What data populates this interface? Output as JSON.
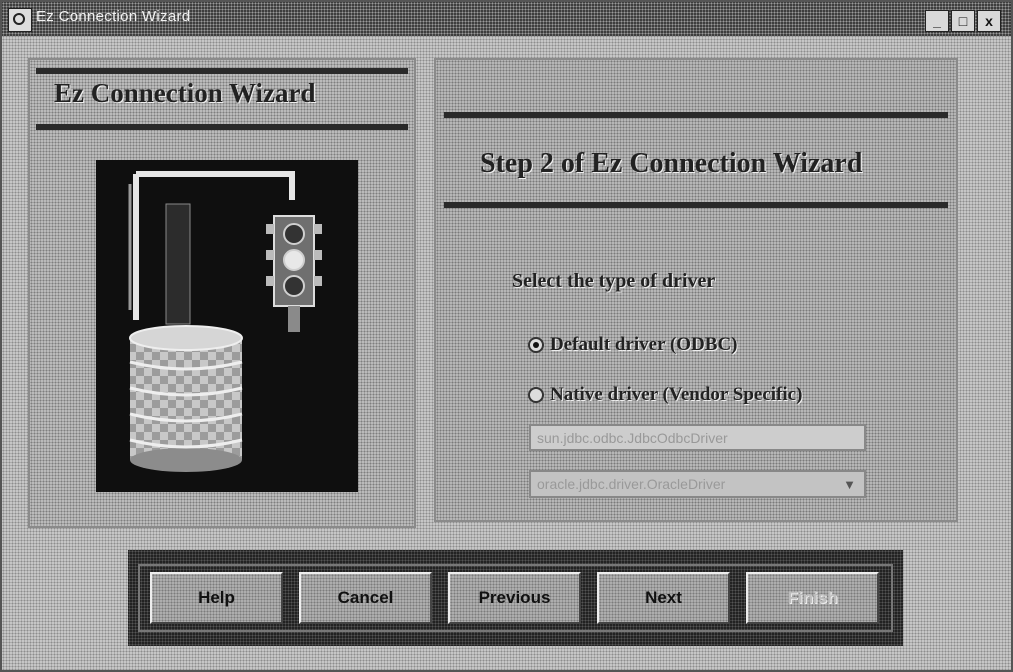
{
  "window": {
    "title": "Ez Connection Wizard",
    "controls": [
      "_",
      "□",
      "x"
    ]
  },
  "left_panel": {
    "title": "Ez Connection Wizard",
    "graphic_icons": [
      "database-icon",
      "traffic-light-icon",
      "cable-icon"
    ]
  },
  "step": {
    "title": "Step 2 of Ez Connection Wizard",
    "prompt": "Select the type of driver"
  },
  "options": {
    "default_label": "Default driver (ODBC)",
    "default_selected": true,
    "native_label": "Native driver (Vendor Specific)",
    "native_selected": false
  },
  "driver": {
    "field_value": "sun.jdbc.odbc.JdbcOdbcDriver",
    "dropdown_value": "oracle.jdbc.driver.OracleDriver"
  },
  "buttons": {
    "help": "Help",
    "cancel": "Cancel",
    "previous": "Previous",
    "next": "Next",
    "finish": "Finish"
  }
}
